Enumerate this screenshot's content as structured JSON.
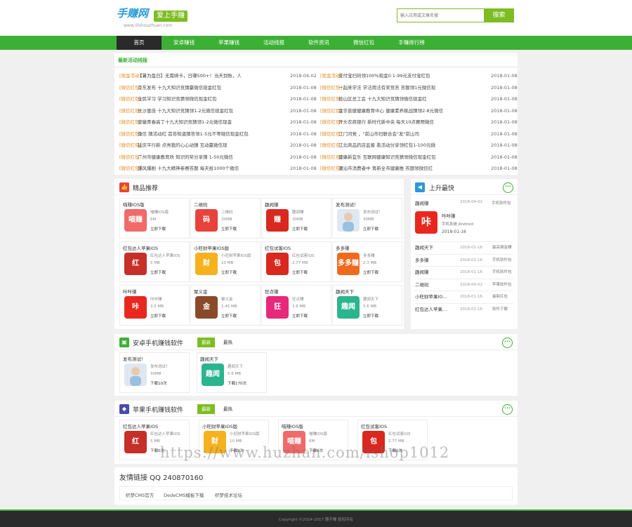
{
  "header": {
    "logo_main": "手赚网",
    "logo_tag": "爱上手赚",
    "logo_url": "www.iitshouzhuan.com",
    "search_placeholder": "输入应用或文章名搜",
    "search_button": "搜索"
  },
  "nav": [
    "首页",
    "安卓赚钱",
    "苹果赚钱",
    "活动线报",
    "软件资讯",
    "微信红包",
    "手赚排行榜"
  ],
  "hot": {
    "title": "最新活动线报",
    "left": [
      {
        "cat": "[现金活动]",
        "text": "【暑为盘日】无需绑卡，日赚500+！当天到账，人",
        "date": "2018-04-02"
      },
      {
        "cat": "[微信红包]",
        "text": "京东发布 十九大知识竞猜赢微信现金红包",
        "date": "2018-01-08"
      },
      {
        "cat": "[微信红包]",
        "text": "全民学习 学习知识竞猜领微信现金红包",
        "date": "2018-01-08"
      },
      {
        "cat": "[微信红包]",
        "text": "长沙富佳 十九大知识竞猜领1-2元微信现金红包",
        "date": "2018-01-08"
      },
      {
        "cat": "[微信红包]",
        "text": "安徽青春高丁十九大知识竞猜领1-2元微信现金",
        "date": "2018-01-08"
      },
      {
        "cat": "[微信红包]",
        "text": "微信 猜活动红 首答知道猜答领1-5元不等微信现金红包",
        "date": "2018-01-08"
      },
      {
        "cat": "[微信红包]",
        "text": "延庆平行新 点亮我的心心动猜 互动赢微信现",
        "date": "2018-01-08"
      },
      {
        "cat": "[微信红包]",
        "text": "广州市健康教育所 知识的奖分享猜 1-50元微信",
        "date": "2018-01-08"
      },
      {
        "cat": "[微信红包]",
        "text": "爆风爆剧 十九大精神参赛答题 每天抢1000个微信",
        "date": "2018-01-08"
      }
    ],
    "right": [
      {
        "cat": "[现金活动]",
        "text": "支付宝扫码领100%现金0.1-99元支付宝红包",
        "date": "2018-01-08"
      },
      {
        "cat": "[微信红包]",
        "text": "一起来学法 学法用法有奖竞答 答题领1元微信现",
        "date": "2018-01-08"
      },
      {
        "cat": "[微信红包]",
        "text": "松山区总工会 十九大知识竞猜领微信现金红",
        "date": "2018-01-08"
      },
      {
        "cat": "[微信红包]",
        "text": "金华普健健康教育中心 健康素养挑战猜领2-8元微信",
        "date": "2018-01-08"
      },
      {
        "cat": "[微信红包]",
        "text": "开头农商银行 新时代新中央 每天10点赛预微信",
        "date": "2018-01-08"
      },
      {
        "cat": "[微信红包]",
        "text": "江门河党 ，\"前山市妇联合会\"发\"前山司",
        "date": "2018-01-08"
      },
      {
        "cat": "[微信红包]",
        "text": "江北商品药店监督 看活动分享领红包1-100元微",
        "date": "2018-01-08"
      },
      {
        "cat": "[微信红包]",
        "text": "健康新宜乐 互联网健康知识竞猜领微信现金红包",
        "date": "2018-01-08"
      },
      {
        "cat": "[微信红包]",
        "text": "潮汕市消费者中 育新全市健康推 答题领微信红",
        "date": "2018-01-08"
      }
    ]
  },
  "featured": {
    "title": "精品推荐",
    "apps": [
      {
        "name": "喵赚IOS版",
        "meta1": "喵赚IOS版",
        "meta2": "6M",
        "dl": "立即下载",
        "icon": "喵赚",
        "color": "#f06a6a"
      },
      {
        "name": "二维码",
        "meta1": "二维码",
        "meta2": "30MB",
        "dl": "立即下载",
        "icon": "码",
        "color": "#e8423d"
      },
      {
        "name": "趣闻赚",
        "meta1": "趣闻赚",
        "meta2": "30MB",
        "dl": "立即下载",
        "icon": "赚",
        "color": "#d8281f"
      },
      {
        "name": "发布测试！",
        "meta1": "发布测试！",
        "meta2": "30MB",
        "dl": "立即下载",
        "icon": "",
        "color": "#dfe8f0"
      },
      {
        "name": "红包达人苹果IOS",
        "meta1": "红包达人苹果IOS",
        "meta2": "5 MB",
        "dl": "立即下载",
        "icon": "红",
        "color": "#c7302a"
      },
      {
        "name": "小旺财苹果IOS版",
        "meta1": "小旺财苹果IOS版",
        "meta2": "10 MB",
        "dl": "立即下载",
        "icon": "财",
        "color": "#f5b21e"
      },
      {
        "name": "红包试客IOS",
        "meta1": "红包试客IOS",
        "meta2": "2.77 MB",
        "dl": "立即下载",
        "icon": "包",
        "color": "#d8281f"
      },
      {
        "name": "多多赚",
        "meta1": "多多赚",
        "meta2": "2.3 MB",
        "dl": "立即下载",
        "icon": "多多赚",
        "color": "#f06a1e"
      },
      {
        "name": "咔咔赚",
        "meta1": "咔咔赚",
        "meta2": "3.5 MB",
        "dl": "立即下载",
        "icon": "咔",
        "color": "#e8281f"
      },
      {
        "name": "聚义金",
        "meta1": "聚义金",
        "meta2": "1.45 MB",
        "dl": "立即下载",
        "icon": "金",
        "color": "#8a4a2a"
      },
      {
        "name": "狂点赚",
        "meta1": "狂点赚",
        "meta2": "3.6 MB",
        "dl": "立即下载",
        "icon": "狂",
        "color": "#e8287a"
      },
      {
        "name": "趣闻天下",
        "meta1": "趣闻天下",
        "meta2": "5.6 MB",
        "dl": "立即下载",
        "icon": "趣闻",
        "color": "#2bb58e"
      }
    ]
  },
  "sidebar": {
    "title": "上升最快",
    "top": {
      "name": "趣闻赚",
      "date": "2018-04-02",
      "tag": "手机软件包",
      "app": "咔咔赚",
      "sys": "手机系统:Android",
      "date2": "2018-01-16",
      "icon": "咔"
    },
    "rows": [
      {
        "name": "趣闻天下",
        "date": "2018-01-16",
        "tag": "最高佣金赚"
      },
      {
        "name": "多多赚",
        "date": "2018-01-16",
        "tag": "手机软件包"
      },
      {
        "name": "趣闻赚",
        "date": "2018-01-16",
        "tag": "手机软件包"
      },
      {
        "name": "二维码",
        "date": "2018-04-02",
        "tag": "苹果软件包"
      },
      {
        "name": "小旺财苹果IO...",
        "date": "2018-01-16",
        "tag": "最新红包"
      },
      {
        "name": "红包达人苹果...",
        "date": "2018-01-16",
        "tag": "软件下载"
      }
    ]
  },
  "android": {
    "title": "安卓手机赚钱软件",
    "tab_on": "最新",
    "tab_off": "最热",
    "apps": [
      {
        "name": "发布测试！",
        "meta1": "发布测试！",
        "meta2": "30MB",
        "dl": "下载10次",
        "icon": "",
        "color": "#dfe8f0"
      },
      {
        "name": "趣闻天下",
        "meta1": "趣闻天下",
        "meta2": "5.6 MB",
        "dl": "下载170次",
        "icon": "趣闻",
        "color": "#2bb58e"
      }
    ]
  },
  "ios": {
    "title": "苹果手机赚钱软件",
    "tab_on": "最新",
    "tab_off": "最热",
    "apps": [
      {
        "name": "红包达人苹果IOS",
        "meta1": "红包达人苹果IOS",
        "meta2": "5 MB",
        "dl": "下载0次",
        "icon": "红",
        "color": "#c7302a"
      },
      {
        "name": "小旺财苹果IOS版",
        "meta1": "小旺财苹果IOS版",
        "meta2": "10 MB",
        "dl": "下载0次",
        "icon": "财",
        "color": "#f5b21e"
      },
      {
        "name": "喵赚IOS版",
        "meta1": "喵赚IOS版",
        "meta2": "6M",
        "dl": "下载0次",
        "icon": "喵赚",
        "color": "#f06a6a"
      },
      {
        "name": "红包试客IOS",
        "meta1": "红包试客IOS",
        "meta2": "2.77 MB",
        "dl": "下载0次",
        "icon": "包",
        "color": "#d8281f"
      }
    ]
  },
  "friends": {
    "title": "友情链接 QQ 240870160",
    "links": [
      "织梦CMS官方",
      "DedeCMS模板下载",
      "织梦技术论坛"
    ]
  },
  "footer": "Copyright ©2014-2017 趣手赚 版权所有",
  "watermark": "https://www.huzhan.com/ishop1012",
  "colors": {
    "green": "#3cb034",
    "light_green": "#7dbd23",
    "orange": "#e38a1f",
    "blue": "#2a9ad8"
  }
}
